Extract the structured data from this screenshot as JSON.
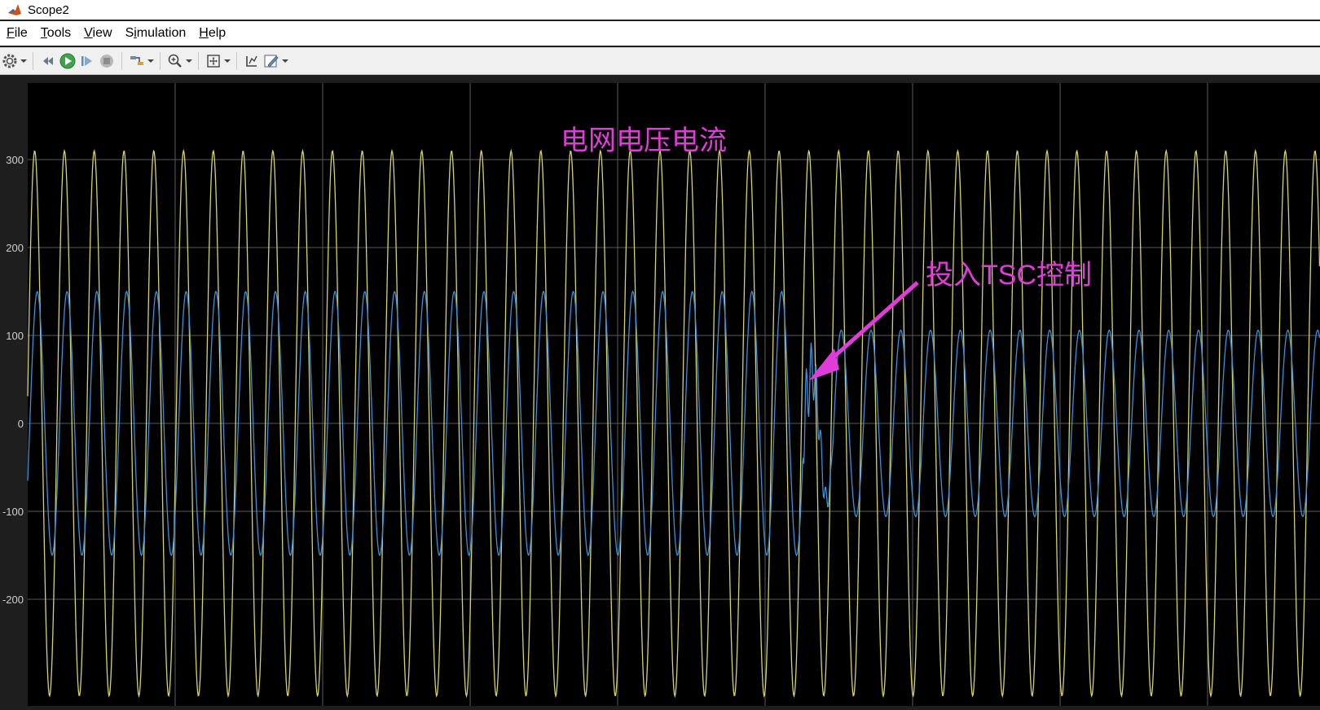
{
  "window": {
    "title": "Scope2"
  },
  "menu": [
    {
      "pre": "",
      "ul": "F",
      "post": "ile"
    },
    {
      "pre": "",
      "ul": "T",
      "post": "ools"
    },
    {
      "pre": "",
      "ul": "V",
      "post": "iew"
    },
    {
      "pre": "S",
      "ul": "i",
      "post": "mulation"
    },
    {
      "pre": "",
      "ul": "H",
      "post": "elp"
    }
  ],
  "toolbar": {
    "icons": [
      "gear-icon",
      "restore-icon",
      "run-icon",
      "step-forward-icon",
      "stop-icon",
      "highlight-icon",
      "zoom-in-icon",
      "fit-axes-icon",
      "cursor-icon",
      "style-icon"
    ]
  },
  "colors": {
    "voltage": "#d6d36a",
    "current": "#3d8fd6",
    "annotation": "#e03cd8",
    "plot_bg": "#000000",
    "grid": "#5a5a5a"
  },
  "annotations": {
    "title": "电网电压电流",
    "tsc_label": "投入TSC控制"
  },
  "chart_data": {
    "type": "line",
    "xlim": [
      0,
      1
    ],
    "ylim": [
      -300,
      390
    ],
    "y_ticks": [
      300,
      200,
      100,
      0,
      -100,
      -200
    ],
    "y_tick_labels": [
      "300",
      "200",
      "100",
      "0",
      "-100",
      "-200"
    ],
    "grid": true,
    "series": [
      {
        "amplitude": 310,
        "cycles": 43.4,
        "phase_offset": 0.0,
        "color": "#d6d36a"
      },
      {
        "amplitude_before": 150,
        "amplitude_after": 106,
        "switch_x": 0.6,
        "cycles": 43.4,
        "phase_offset": -0.45,
        "color": "#3d8fd6"
      }
    ]
  }
}
